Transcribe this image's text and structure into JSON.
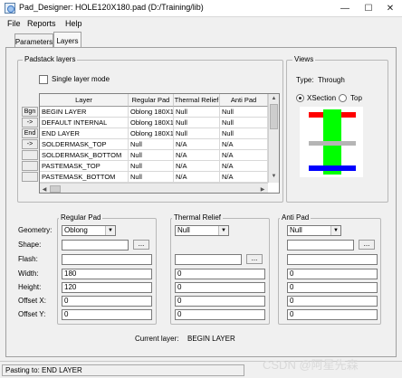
{
  "window": {
    "title": "Pad_Designer: HOLE120X180.pad (D:/Training/lib)"
  },
  "menu": {
    "items": [
      "File",
      "Reports",
      "Help"
    ]
  },
  "tabs": [
    {
      "label": "Parameters"
    },
    {
      "label": "Layers"
    }
  ],
  "padstack": {
    "group_title": "Padstack layers",
    "single_layer_mode": {
      "label": "Single layer mode",
      "checked": false
    },
    "columns": [
      "Layer",
      "Regular Pad",
      "Thermal Relief",
      "Anti Pad"
    ],
    "rows": [
      {
        "btn": "Bgn",
        "layer": "BEGIN LAYER",
        "regular": "Oblong 180X120",
        "thermal": "Null",
        "anti": "Null"
      },
      {
        "btn": "->",
        "layer": "DEFAULT INTERNAL",
        "regular": "Oblong 180X120",
        "thermal": "Null",
        "anti": "Null"
      },
      {
        "btn": "End",
        "layer": "END LAYER",
        "regular": "Oblong 180X120",
        "thermal": "Null",
        "anti": "Null"
      },
      {
        "btn": "->",
        "layer": "SOLDERMASK_TOP",
        "regular": "Null",
        "thermal": "N/A",
        "anti": "N/A"
      },
      {
        "btn": "",
        "layer": "SOLDERMASK_BOTTOM",
        "regular": "Null",
        "thermal": "N/A",
        "anti": "N/A"
      },
      {
        "btn": "",
        "layer": "PASTEMASK_TOP",
        "regular": "Null",
        "thermal": "N/A",
        "anti": "N/A"
      },
      {
        "btn": "",
        "layer": "PASTEMASK_BOTTOM",
        "regular": "Null",
        "thermal": "N/A",
        "anti": "N/A"
      }
    ]
  },
  "views": {
    "group_title": "Views",
    "type_label": "Type:",
    "type_value": "Through",
    "xsection_label": "XSection",
    "top_label": "Top",
    "selected": "XSection",
    "colors": {
      "top": "#ff0000",
      "pad": "#00ff00",
      "mid": "#b5b5b5",
      "bottom": "#0000ff"
    }
  },
  "regular_pad": {
    "title": "Regular Pad",
    "geometry_label": "Geometry:",
    "geometry_value": "Oblong",
    "shape_label": "Shape:",
    "shape_value": "",
    "flash_label": "Flash:",
    "flash_value": "",
    "browse_label": "...",
    "width_label": "Width:",
    "width_value": "180",
    "height_label": "Height:",
    "height_value": "120",
    "offset_x_label": "Offset X:",
    "offset_x_value": "0",
    "offset_y_label": "Offset Y:",
    "offset_y_value": "0"
  },
  "thermal_relief": {
    "title": "Thermal Relief",
    "geometry_value": "Null",
    "width_value": "0",
    "height_value": "0",
    "offset_x_value": "0",
    "offset_y_value": "0"
  },
  "anti_pad": {
    "title": "Anti Pad",
    "geometry_value": "Null",
    "width_value": "0",
    "height_value": "0",
    "offset_x_value": "0",
    "offset_y_value": "0"
  },
  "current_layer": {
    "label": "Current layer:",
    "value": "BEGIN LAYER"
  },
  "status": {
    "text": "Pasting to: END LAYER"
  },
  "watermark": "CSDN @阿星先森"
}
